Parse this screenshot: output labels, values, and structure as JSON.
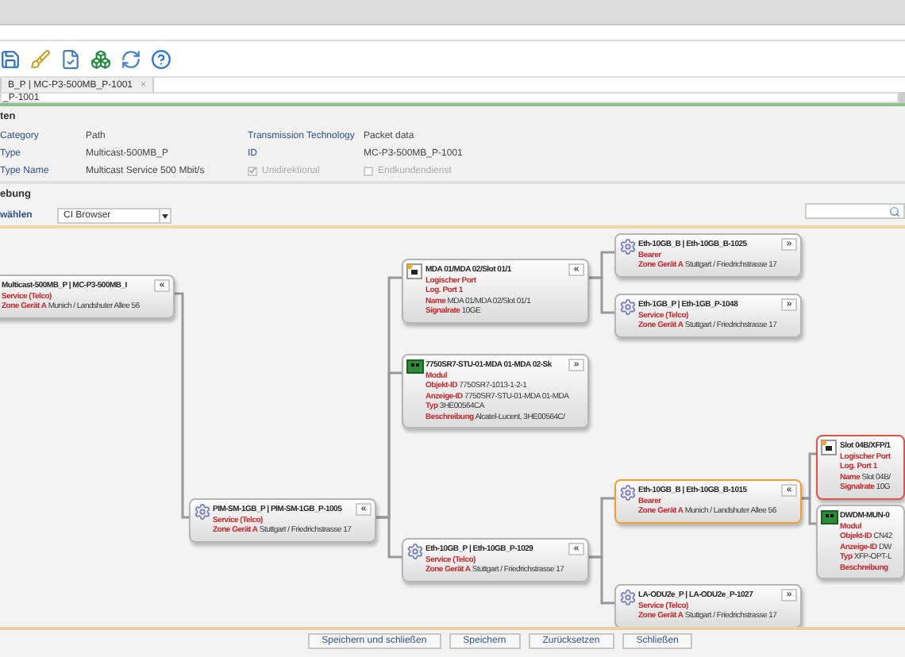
{
  "tab": {
    "label": "B_P | MC-P3-500MB_P-1001",
    "close": "×"
  },
  "path_field": {
    "value": "_P-1001"
  },
  "details": {
    "heading": "ten",
    "rows": [
      {
        "label": "Category",
        "value": "Path",
        "label2": "Transmission Technology",
        "value2": "Packet data"
      },
      {
        "label": "Type",
        "value": "Multicast-500MB_P",
        "label2": "ID",
        "value2": "MC-P3-500MB_P-1001"
      },
      {
        "label": "Type Name",
        "value": "Multicast Service 500 Mbit/s"
      }
    ],
    "checkboxes": [
      {
        "label": "Unidirektional",
        "checked": true
      },
      {
        "label": "Endkundendienst",
        "checked": false
      }
    ]
  },
  "environment": {
    "heading": "ebung",
    "select_label": "wählen",
    "select_value": "CI Browser"
  },
  "graph": {
    "title": "Multicast-500MB_P | MC-P3-500MB_I",
    "toggle": "«",
    "selected": false,
    "flagged": false,
    "lines": [
      {
        "label": "Service (Telco)"
      },
      {
        "label": "Zone Gerät A",
        "value": "Munich / Landshuter Allee 56"
      }
    ],
    "children": [
      {
        "kind": "service",
        "title": "PIM-SM-1GB_P | PIM-SM-1GB_P-1005",
        "toggle": "«",
        "selected": false,
        "flagged": false,
        "lines": [
          {
            "label": "Service (Telco)"
          },
          {
            "label": "Zone Gerät A",
            "value": "Stuttgart / Friedrichstrasse 17"
          }
        ],
        "children": [
          {
            "kind": "port",
            "title": "MDA 01/MDA 02/Slot 01/1",
            "toggle": "«",
            "selected": false,
            "flagged": false,
            "lines": [
              {
                "label": "Logischer Port"
              },
              {
                "label": "Log. Port 1"
              },
              {
                "label": "Name",
                "value": "MDA 01/MDA 02/Slot 01/1"
              },
              {
                "label": "Signalrate",
                "value": "10GE"
              }
            ],
            "children": [
              {
                "kind": "service",
                "title": "Eth-10GB_B | Eth-10GB_B-1025",
                "toggle": "»",
                "selected": false,
                "flagged": false,
                "lines": [
                  {
                    "label": "Bearer"
                  },
                  {
                    "label": "Zone Gerät A",
                    "value": "Stuttgart / Friedrichstrasse 17"
                  }
                ]
              },
              {
                "kind": "service",
                "title": "Eth-1GB_P | Eth-1GB_P-1048",
                "toggle": "»",
                "selected": false,
                "flagged": false,
                "lines": [
                  {
                    "label": "Service (Telco)"
                  },
                  {
                    "label": "Zone Gerät A",
                    "value": "Stuttgart / Friedrichstrasse 17"
                  }
                ]
              }
            ]
          },
          {
            "kind": "module",
            "title": "7750SR7-STU-01-MDA 01-MDA 02-Sk",
            "toggle": "»",
            "selected": false,
            "flagged": false,
            "lines": [
              {
                "label": "Modul"
              },
              {
                "label": "Objekt-ID",
                "value": "7750SR7-1013-1-2-1"
              },
              {
                "label": "Anzeige-ID",
                "value": "7750SR7-STU-01-MDA 01-MDA"
              },
              {
                "label": "Typ",
                "value": "3HE00564CA"
              },
              {
                "label": "Beschreibung",
                "value": "Alcatel-Lucent, 3HE00564C/"
              }
            ]
          },
          {
            "kind": "service",
            "title": "Eth-10GB_P | Eth-10GB_P-1029",
            "toggle": "«",
            "selected": false,
            "flagged": false,
            "lines": [
              {
                "label": "Service (Telco)"
              },
              {
                "label": "Zone Gerät A",
                "value": "Stuttgart / Friedrichstrasse 17"
              }
            ],
            "children": [
              {
                "kind": "service",
                "title": "Eth-10GB_B | Eth-10GB_B-1015",
                "toggle": "«",
                "selected": true,
                "flagged": false,
                "lines": [
                  {
                    "label": "Bearer"
                  },
                  {
                    "label": "Zone Gerät A",
                    "value": "Munich / Landshuter Allee 56"
                  }
                ],
                "children": [
                  {
                    "kind": "port",
                    "title": "Slot 04B/XFP/1",
                    "selected": false,
                    "flagged": true,
                    "lines": [
                      {
                        "label": "Logischer Port"
                      },
                      {
                        "label": "Log. Port 1"
                      },
                      {
                        "label": "Name",
                        "value": "Slot 04B/"
                      },
                      {
                        "label": "Signalrate",
                        "value": "10G"
                      }
                    ]
                  },
                  {
                    "kind": "module",
                    "title": "DWDM-MUN-0",
                    "selected": false,
                    "flagged": false,
                    "lines": [
                      {
                        "label": "Modul"
                      },
                      {
                        "label": "Objekt-ID",
                        "value": "CN42"
                      },
                      {
                        "label": "Anzeige-ID",
                        "value": "DW"
                      },
                      {
                        "label": "Typ",
                        "value": "XFP-OPT-L"
                      },
                      {
                        "label": "Beschreibung"
                      }
                    ]
                  }
                ]
              },
              {
                "kind": "service",
                "title": "LA-ODU2e_P | LA-ODU2e_P-1027",
                "toggle": "»",
                "selected": false,
                "flagged": false,
                "lines": [
                  {
                    "label": "Service (Telco)"
                  },
                  {
                    "label": "Zone Gerät A",
                    "value": "Stuttgart / Friedrichstrasse 17"
                  }
                ]
              }
            ]
          }
        ]
      }
    ]
  },
  "buttons": [
    "Speichern und schließen",
    "Speichern",
    "Zurücksetzen",
    "Schließen"
  ]
}
